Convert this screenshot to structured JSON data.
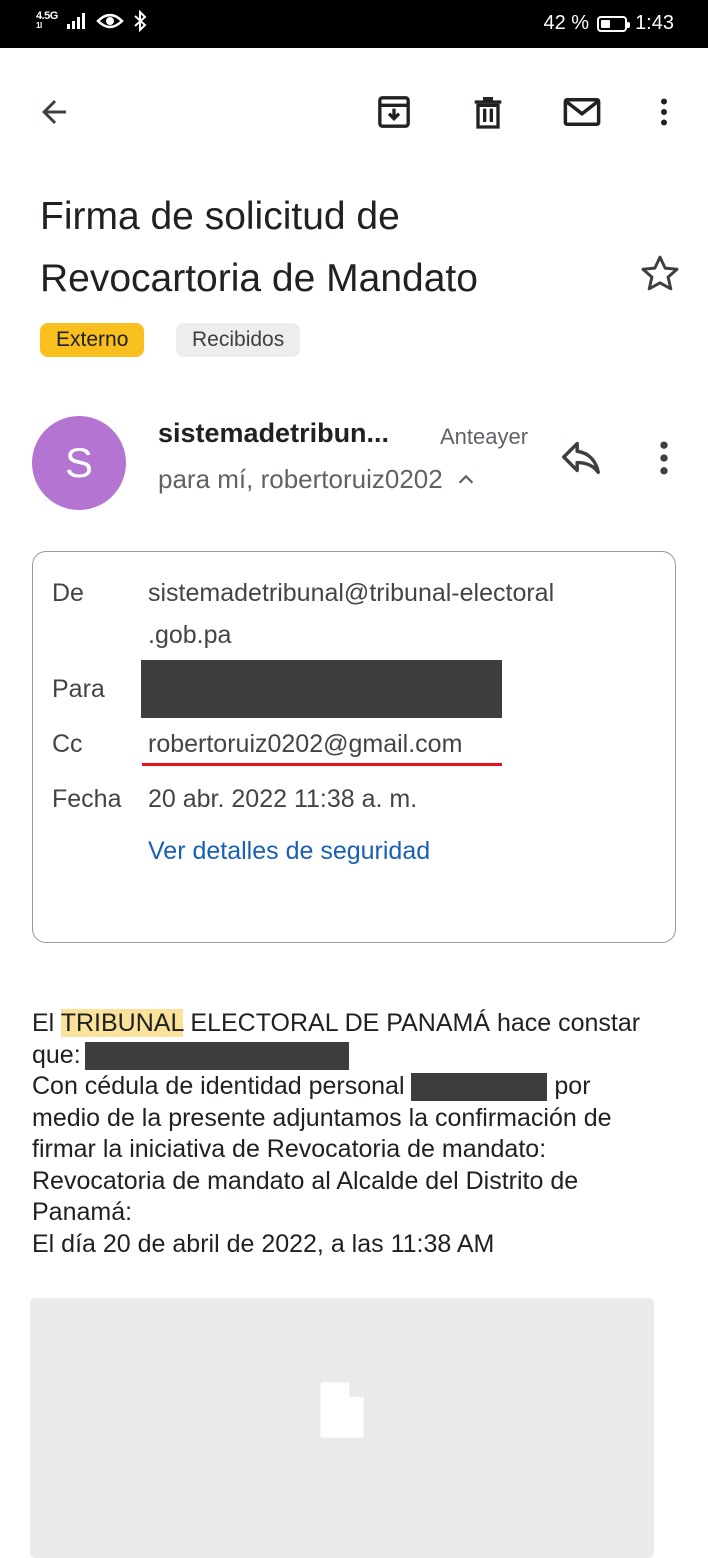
{
  "status_bar": {
    "network": "4.5G",
    "network_sub": "1l",
    "battery_percent": "42 %",
    "time": "1:43",
    "battery_level": 0.42
  },
  "toolbar": {
    "back_icon": "arrow-left-icon",
    "archive_icon": "archive-icon",
    "delete_icon": "trash-icon",
    "mark_unread_icon": "mail-icon",
    "more_icon": "more-vert-icon"
  },
  "email": {
    "subject_line1": "Firma de solicitud de",
    "subject_line2": "Revocartoria de Mandato",
    "labels": [
      "Externo",
      "Recibidos"
    ],
    "avatar_letter": "S",
    "avatar_color": "#b474d1",
    "sender_short": "sistemadetribun...",
    "received": "Anteayer",
    "recipients": "para mí, robertoruiz0202",
    "details": {
      "from_label": "De",
      "from_value_line1": "sistemadetribunal@tribunal-electoral",
      "from_value_line2": ".gob.pa",
      "to_label": "Para",
      "cc_label": "Cc",
      "cc_value": "robertoruiz0202@gmail.com",
      "date_label": "Fecha",
      "date_value": "20 abr. 2022 11:38 a. m.",
      "security_link": "Ver detalles de seguridad"
    },
    "body": {
      "line1_pre": "El ",
      "line1_highlight": "TRIBUNAL",
      "line1_post": " ELECTORAL DE PANAMÁ hace constar",
      "line2": "que:",
      "line3_pre": "Con cédula de identidad personal ",
      "line3_post": " por",
      "line4": "medio de la presente adjuntamos la confirmación de",
      "line5": "firmar la iniciativa de Revocatoria de mandato:",
      "line6": "Revocatoria de mandato al Alcalde del Distrito de",
      "line7": "Panamá:",
      "line8": "El día 20 de abril de 2022, a las 11:38 AM"
    },
    "attachment_icon": "file-icon"
  },
  "colors": {
    "external_chip": "#f9bf1f",
    "inbox_chip": "#ededed",
    "link": "#1a5fb4",
    "annotation_underline": "#e8101c",
    "highlight": "#fbe29b"
  }
}
